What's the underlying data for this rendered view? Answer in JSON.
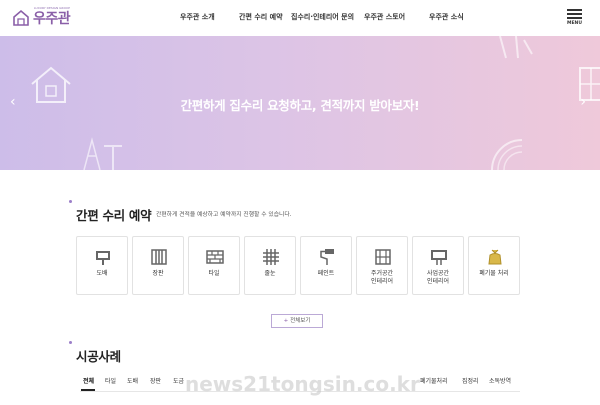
{
  "header": {
    "logo_text": "우주관",
    "logo_small": "LUXURY DESIGN GROUP",
    "menu_label": "MENU",
    "nav": [
      "우주관 소개",
      "간편 수리 예약",
      "집수리·인테리어 문의",
      "우주관 스토어",
      "우주관 소식"
    ]
  },
  "hero": {
    "headline": "간편하게 집수리 요청하고, 견적까지 받아보자!",
    "prev_arrow": "‹",
    "next_arrow": "›"
  },
  "booking": {
    "title": "간편 수리 예약",
    "description": "간편하게 견적을 예상하고 예약까지 진행할 수 있습니다.",
    "cards": [
      {
        "label": "도배",
        "icon": "wallpaper-icon"
      },
      {
        "label": "장판",
        "icon": "flooring-icon"
      },
      {
        "label": "타일",
        "icon": "tile-icon"
      },
      {
        "label": "줄눈",
        "icon": "grout-icon"
      },
      {
        "label": "페인트",
        "icon": "paint-roller-icon"
      },
      {
        "label": "주거공간\n인테리어",
        "icon": "residential-interior-icon"
      },
      {
        "label": "사업공간\n인테리어",
        "icon": "commercial-interior-icon"
      },
      {
        "label": "폐기물 처리",
        "icon": "waste-bag-icon"
      }
    ],
    "more_button": "전체보기",
    "more_plus": "+"
  },
  "cases": {
    "title": "시공사례",
    "tabs": [
      "전체",
      "타일",
      "도배",
      "장판",
      "도금",
      "",
      "",
      "",
      "",
      "",
      "",
      "",
      "",
      "",
      "폐기물처리",
      "집정리",
      "소독방역"
    ]
  },
  "watermark": "news21tongsin.co.kr",
  "colors": {
    "accent": "#8a5fa8",
    "hero_left": "#cdbde9",
    "hero_right": "#efc9da"
  }
}
